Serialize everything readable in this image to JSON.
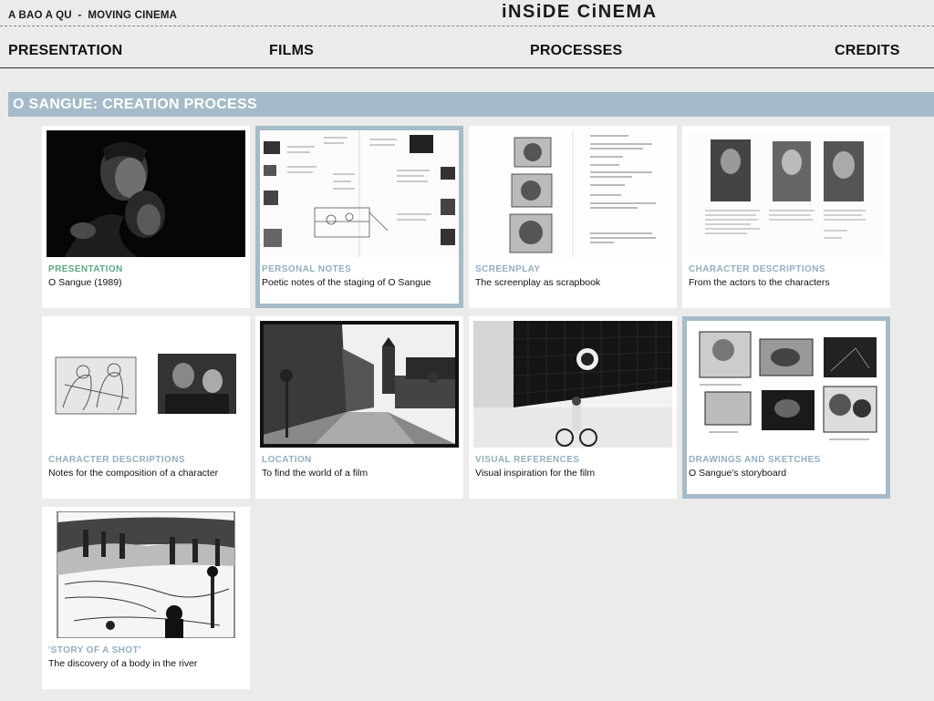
{
  "header": {
    "brand": "A BAO A QU  -  MOVING CINEMA",
    "site_title": "iNSiDE CiNEMA"
  },
  "nav": {
    "items": [
      "PRESENTATION",
      "FILMS",
      "PROCESSES",
      "CREDITS"
    ]
  },
  "section": {
    "title": "O SANGUE: CREATION PROCESS"
  },
  "cards": [
    {
      "category": "PRESENTATION",
      "description": "O Sangue (1989)",
      "image": "film-still-image"
    },
    {
      "category": "PERSONAL NOTES",
      "description": "Poetic notes of the staging of O Sangue",
      "image": "notes-page-image"
    },
    {
      "category": "SCREENPLAY",
      "description": "The screenplay as scrapbook",
      "image": "screenplay-page-image"
    },
    {
      "category": "CHARACTER DESCRIPTIONS",
      "description": "From the actors to the characters",
      "image": "actor-portraits-image"
    },
    {
      "category": "CHARACTER DESCRIPTIONS",
      "description": "Notes for the composition of a character",
      "image": "character-sketch-image"
    },
    {
      "category": "LOCATION",
      "description": "To find the world of a film",
      "image": "street-photo-image"
    },
    {
      "category": "VISUAL REFERENCES",
      "description": "Visual inspiration for the film",
      "image": "architecture-photo-image"
    },
    {
      "category": "DRAWINGS AND SKETCHES",
      "description": "O Sangue's storyboard",
      "image": "storyboard-drawings-image"
    },
    {
      "category": "'STORY OF A SHOT'",
      "description": "The discovery of a body in the river",
      "image": "shot-drawing-image"
    }
  ],
  "colors": {
    "accent": "#a5bbc9",
    "category_text": "#94adbf",
    "presentation_category": "#5fa884",
    "background": "#ebebeb"
  }
}
